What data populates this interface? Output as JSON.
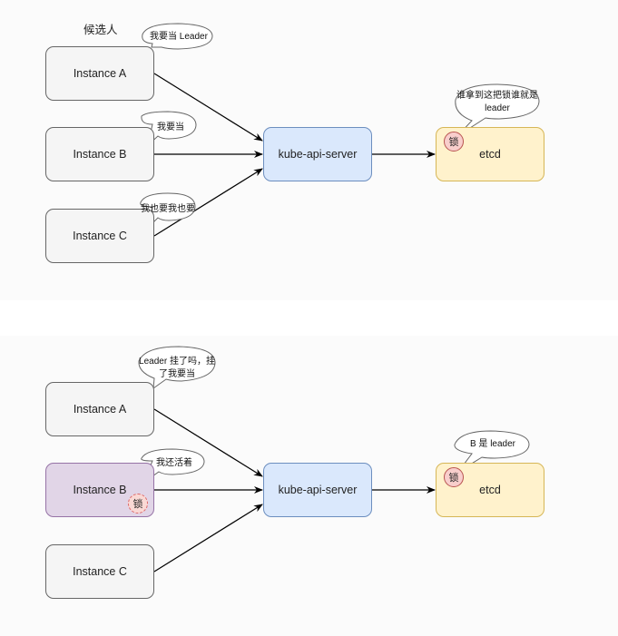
{
  "top": {
    "candidates_label": "候选人",
    "instances": [
      {
        "label": "Instance A",
        "speech": "我要当 Leader"
      },
      {
        "label": "Instance B",
        "speech": "我要当"
      },
      {
        "label": "Instance C",
        "speech": "我也要我也要"
      }
    ],
    "api_server": "kube-api-server",
    "etcd": "etcd",
    "lock": "锁",
    "etcd_speech": "谁拿到这把锁谁就是leader"
  },
  "bottom": {
    "instances": [
      {
        "label": "Instance A",
        "speech": "Leader 挂了吗，挂了我要当"
      },
      {
        "label": "Instance B",
        "speech": "我还活着",
        "holds_lock": true
      },
      {
        "label": "Instance C"
      }
    ],
    "api_server": "kube-api-server",
    "etcd": "etcd",
    "lock": "锁",
    "etcd_speech": "B 是 leader"
  }
}
